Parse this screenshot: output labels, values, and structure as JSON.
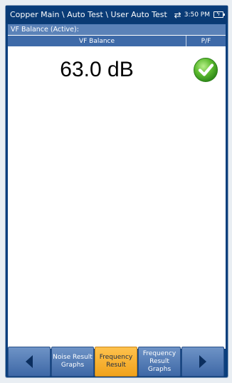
{
  "window": {
    "breadcrumb": "Copper Main \\ Auto Test \\ User Auto Test",
    "time": "3:50 PM",
    "icons": [
      "swap-arrows-icon",
      "battery-charging-icon"
    ]
  },
  "section": {
    "title": "VF Balance (Active):"
  },
  "table": {
    "columns": [
      "VF Balance",
      "P/F"
    ],
    "rows": [
      {
        "value": "63.0 dB",
        "pass_fail": "pass",
        "pass_fail_icon": "pass-check-icon"
      }
    ]
  },
  "nav": {
    "prev_icon": "left-arrow-icon",
    "next_icon": "right-arrow-icon",
    "buttons": [
      {
        "label": "Noise Result Graphs",
        "active": false
      },
      {
        "label": "Frequency Result",
        "active": true
      },
      {
        "label": "Frequency Result Graphs",
        "active": false
      }
    ]
  },
  "colors": {
    "frame": "#0b3f7d",
    "header": "#5b82b8",
    "column_header": "#3e6aa8",
    "active_button": "#f0a21c",
    "pass": "#5dbb2f"
  }
}
